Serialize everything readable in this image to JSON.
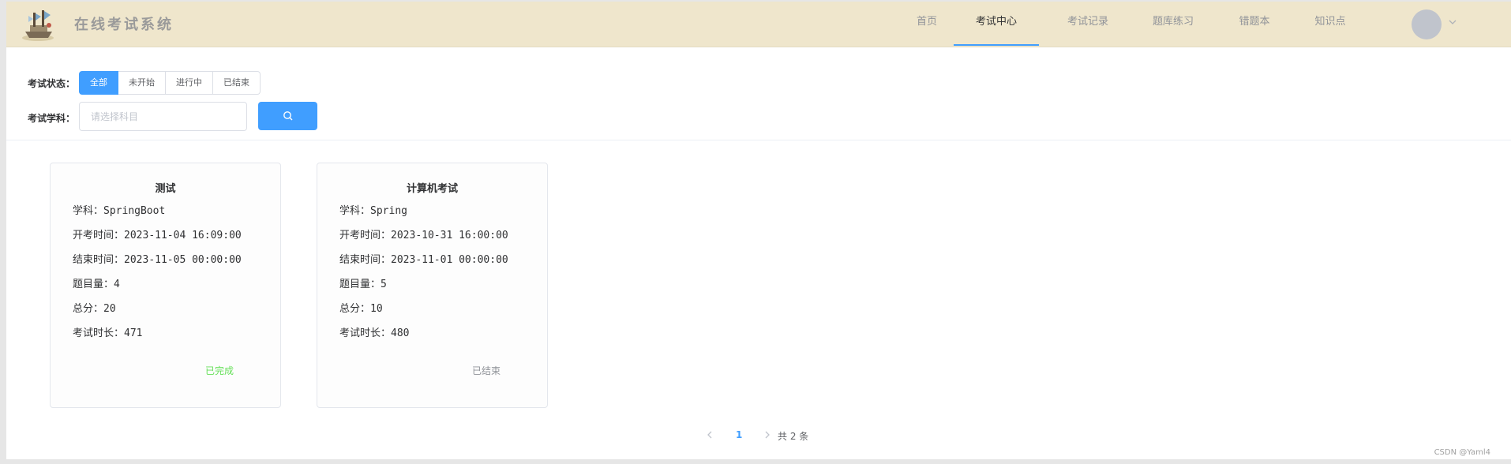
{
  "app": {
    "brand_title": "在线考试系统"
  },
  "nav": {
    "items": [
      {
        "label": "首页"
      },
      {
        "label": "考试中心",
        "active": true
      },
      {
        "label": "考试记录"
      },
      {
        "label": "题库练习"
      },
      {
        "label": "错题本"
      },
      {
        "label": "知识点"
      }
    ]
  },
  "filters": {
    "status_label": "考试状态：",
    "status_options": [
      "全部",
      "未开始",
      "进行中",
      "已结束"
    ],
    "status_selected": "全部",
    "subject_label": "考试学科：",
    "subject_placeholder": "请选择科目",
    "subject_value": ""
  },
  "exams": [
    {
      "title": "测试",
      "subject_label": "学科：",
      "subject": "SpringBoot",
      "start_label": "开考时间：",
      "start": "2023-11-04 16:09:00",
      "end_label": "结束时间：",
      "end": "2023-11-05 00:00:00",
      "count_label": "题目量：",
      "count": "4",
      "score_label": "总分：",
      "score": "20",
      "duration_label": "考试时长：",
      "duration": "471",
      "status": "已完成",
      "status_color": "#67e05a"
    },
    {
      "title": "计算机考试",
      "subject_label": "学科：",
      "subject": "Spring",
      "start_label": "开考时间：",
      "start": "2023-10-31 16:00:00",
      "end_label": "结束时间：",
      "end": "2023-11-01 00:00:00",
      "count_label": "题目量：",
      "count": "5",
      "score_label": "总分：",
      "score": "10",
      "duration_label": "考试时长：",
      "duration": "480",
      "status": "已结束",
      "status_color": "#909399"
    }
  ],
  "pagination": {
    "current_page": "1",
    "total_text": "共 2 条"
  },
  "watermark": "CSDN @Yaml4",
  "colors": {
    "primary": "#409eff",
    "header_bg": "#efe6cc"
  },
  "icons": {
    "search": "search-icon",
    "prev": "chevron-left-icon",
    "next": "chevron-right-icon",
    "caret": "chevron-down-icon"
  }
}
